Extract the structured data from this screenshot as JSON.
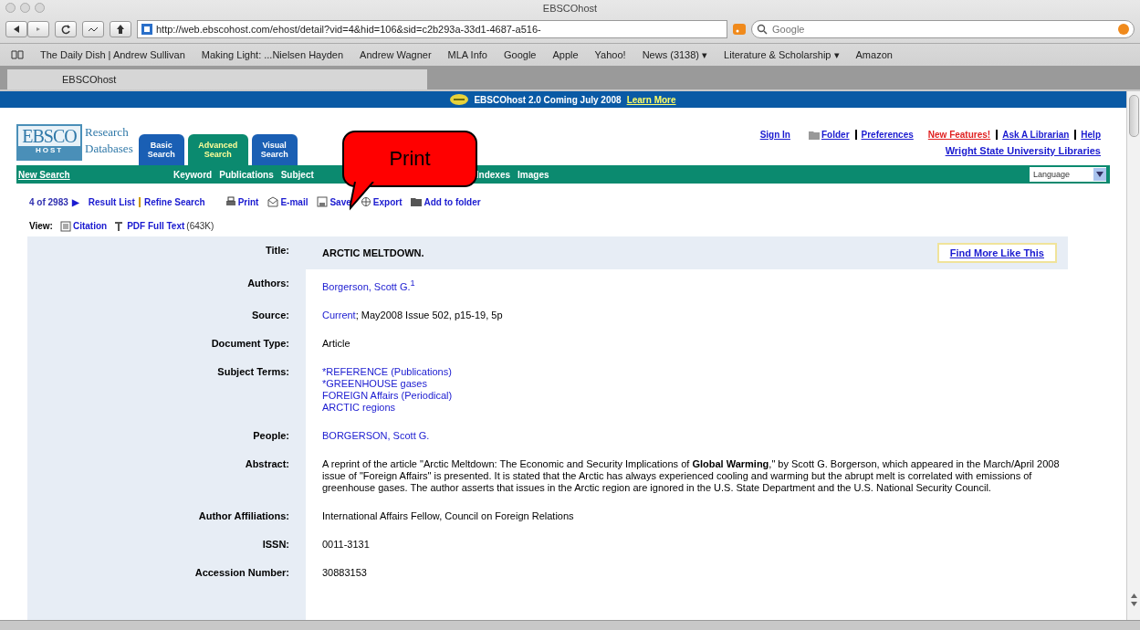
{
  "window": {
    "title": "EBSCOhost"
  },
  "toolbar": {
    "url": "http://web.ebscohost.com/ehost/detail?vid=4&hid=106&sid=c2b293a-33d1-4687-a516-",
    "search_placeholder": "Google"
  },
  "bookmarks": [
    "The Daily Dish | Andrew Sullivan",
    "Making Light: ...Nielsen Hayden",
    "Andrew Wagner",
    "MLA Info",
    "Google",
    "Apple",
    "Yahoo!",
    "News (3138) ▾",
    "Literature & Scholarship ▾",
    "Amazon"
  ],
  "tabs": [
    {
      "label": "EBSCOhost",
      "selected": true
    }
  ],
  "banner": {
    "text": "EBSCOhost 2.0  Coming July 2008",
    "link": "Learn More"
  },
  "header": {
    "logo_top": "EBSCO",
    "logo_bottom": "HOST",
    "caption": [
      "Research",
      "Databases"
    ],
    "search_tabs": [
      {
        "label": "Basic Search",
        "selected": false
      },
      {
        "label": "Advanced Search",
        "selected": true
      },
      {
        "label": "Visual Search",
        "selected": false
      }
    ],
    "top_links": [
      {
        "label": "Sign In",
        "kind": "link"
      },
      {
        "label": "Folder",
        "kind": "folder"
      },
      {
        "label": "Preferences",
        "kind": "link"
      },
      {
        "label": "New Features!",
        "kind": "alert"
      },
      {
        "label": "Ask A Librarian",
        "kind": "link"
      },
      {
        "label": "Help",
        "kind": "link"
      }
    ],
    "institution": "Wright State University Libraries"
  },
  "nav": {
    "new_search": "New Search",
    "items": [
      "Keyword",
      "Publications",
      "Subject",
      "Indexes",
      "Images"
    ],
    "language": "Language"
  },
  "result_toolbar": {
    "position": "4 of 2983",
    "next": "▶",
    "links": [
      "Result List",
      "Refine Search"
    ],
    "actions": [
      {
        "label": "Print",
        "kind": "print"
      },
      {
        "label": "E-mail",
        "kind": "email"
      },
      {
        "label": "Save",
        "kind": "save"
      },
      {
        "label": "Export",
        "kind": "export"
      },
      {
        "label": "Add to folder",
        "kind": "folder"
      }
    ]
  },
  "view": {
    "label": "View:",
    "items": [
      {
        "label": "Citation",
        "kind": "citation"
      },
      {
        "label": "PDF Full Text",
        "kind": "pdf",
        "size": "(643K)"
      }
    ]
  },
  "record": {
    "title_label": "Title:",
    "title": "ARCTIC MELTDOWN.",
    "find_more": "Find More Like This",
    "fields": [
      {
        "label": "Authors:",
        "kind": "links",
        "values": [
          "Borgerson, Scott G.$^{1}$"
        ]
      },
      {
        "label": "Source:",
        "kind": "source",
        "link": "Current",
        "text": "; May2008 Issue 502, p15-19, 5p"
      },
      {
        "label": "Document Type:",
        "kind": "text",
        "text": "Article"
      },
      {
        "label": "Subject Terms:",
        "kind": "links",
        "values": [
          "*REFERENCE (Publications)",
          "*GREENHOUSE gases",
          "FOREIGN Affairs (Periodical)",
          "ARCTIC regions"
        ]
      },
      {
        "label": "People:",
        "kind": "links",
        "values": [
          "BORGERSON, Scott G."
        ]
      },
      {
        "label": "Abstract:",
        "kind": "text",
        "text": "A reprint of the article \"Arctic Meltdown: The Economic and Security Implications of **Global Warming**,\" by Scott G. Borgerson, which appeared in the March/April 2008 issue of \"Foreign Affairs\" is presented. It is stated that the Arctic has always experienced cooling and warming but the abrupt melt is correlated with emissions of greenhouse gases. The author asserts that issues in the Arctic region are ignored in the U.S. State Department and the U.S. National Security Council."
      },
      {
        "label": "Author Affiliations:",
        "kind": "text",
        "text": "International Affairs Fellow, Council on Foreign Relations"
      },
      {
        "label": "ISSN:",
        "kind": "text",
        "text": "0011-3131"
      },
      {
        "label": "Accession Number:",
        "kind": "text",
        "text": "30883153"
      }
    ]
  },
  "callout": {
    "text": "Print"
  }
}
